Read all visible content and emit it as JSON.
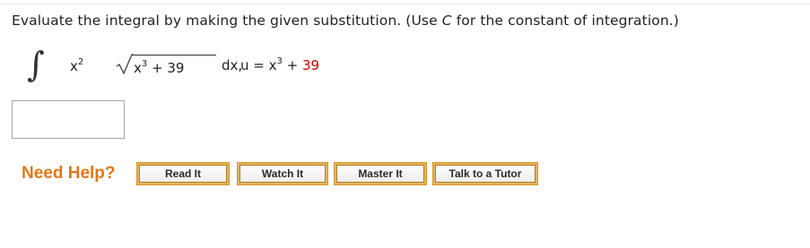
{
  "question": {
    "prompt_before": "Evaluate the integral by making the given substitution. (Use ",
    "prompt_var": "C",
    "prompt_after": " for the constant of integration.)",
    "integral_symbol": "∫",
    "factor_base": "x",
    "factor_exp": "2",
    "radicand_base": "x",
    "radicand_exp": "3",
    "radicand_rest": " + 39",
    "differential": "dx,",
    "sub_lhs": "u = x",
    "sub_exp": "3",
    "sub_plus": " + ",
    "sub_const": "39"
  },
  "answer": {
    "value": ""
  },
  "help": {
    "label": "Need Help?",
    "buttons": [
      "Read It",
      "Watch It",
      "Master It",
      "Talk to a Tutor"
    ]
  },
  "colors": {
    "need_help": "#e07818",
    "button_border": "#d6952e",
    "substitution_constant": "#cc0000"
  }
}
